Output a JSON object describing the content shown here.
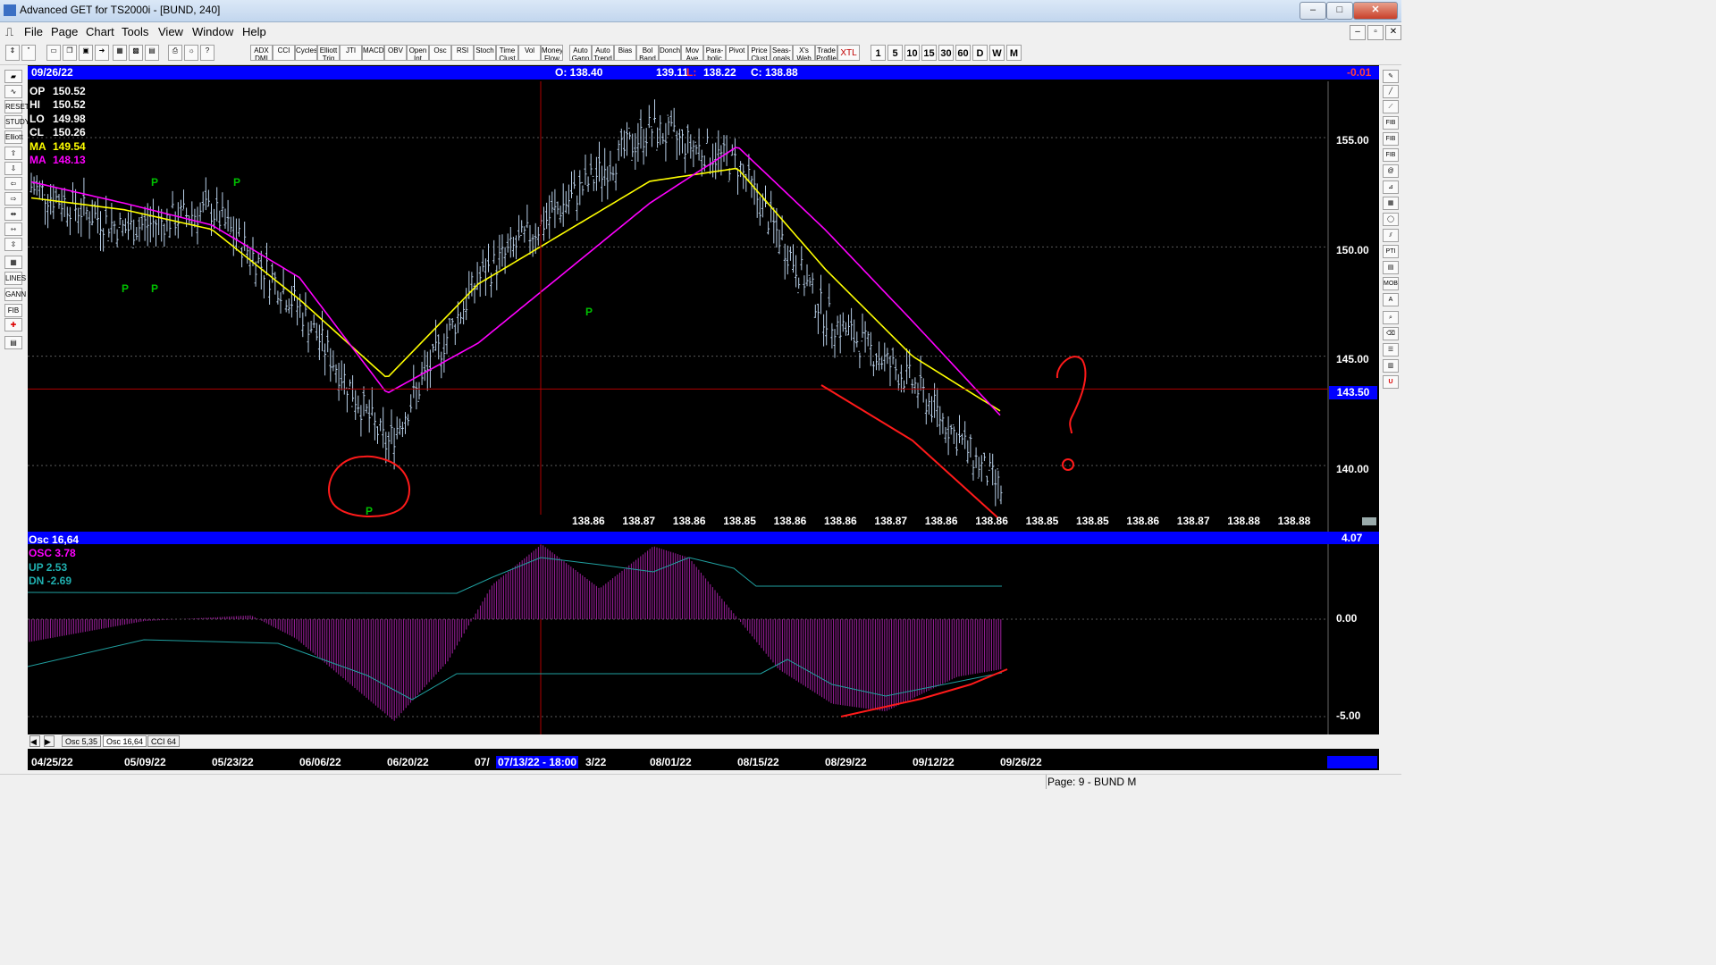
{
  "window": {
    "title": "Advanced GET for TS2000i - [BUND, 240]"
  },
  "menu": [
    "File",
    "Page",
    "Chart",
    "Tools",
    "View",
    "Window",
    "Help"
  ],
  "toolbar": {
    "indicators": [
      "ADX DMI",
      "CCI",
      "Cycles",
      "Elliott Trig",
      "JTI",
      "MACD",
      "OBV",
      "Open Int",
      "Osc",
      "RSI",
      "Stoch",
      "Time Clust",
      "Vol",
      "Money Flow",
      "Auto Gann",
      "Auto Trend",
      "Bias",
      "Bol Band",
      "Donch",
      "Mov Ave",
      "Para-bolic",
      "Pivot",
      "Price Clust",
      "Seas-onals",
      "X's Web",
      "Trade Profile",
      "XTL"
    ],
    "timeframes": [
      "1",
      "5",
      "10",
      "15",
      "30",
      "60",
      "D",
      "W",
      "M"
    ]
  },
  "lefttools": [
    "RESET",
    "STUDY",
    "Elliott",
    "LINES",
    "GANN",
    "FIB"
  ],
  "righttools": [
    "FIB RET",
    "FIB EXT",
    "FIB TIME",
    "PTI",
    "MOB"
  ],
  "header": {
    "date": "09/26/22",
    "open": "O: 138.40",
    "high": "139.11",
    "low_label": "L:",
    "low": "138.22",
    "close": "C: 138.88",
    "change": "-0.01"
  },
  "readout": [
    {
      "label": "OP",
      "value": "150.52",
      "color": "#ffffff"
    },
    {
      "label": "HI",
      "value": "150.52",
      "color": "#ffffff"
    },
    {
      "label": "LO",
      "value": "149.98",
      "color": "#ffffff"
    },
    {
      "label": "CL",
      "value": "150.26",
      "color": "#ffffff"
    },
    {
      "label": "MA",
      "value": "149.54",
      "color": "#ffff00"
    },
    {
      "label": "MA",
      "value": "148.13",
      "color": "#ff00ff"
    }
  ],
  "price_axis": [
    "155.00",
    "150.00",
    "145.00",
    "140.00"
  ],
  "cursor_price": "143.50",
  "projection_row": [
    "138.86",
    "138.87",
    "138.86",
    "138.85",
    "138.86",
    "138.86",
    "138.87",
    "138.86",
    "138.86",
    "138.85",
    "138.85",
    "138.86",
    "138.87",
    "138.88",
    "138.88"
  ],
  "pivot_marker": "P",
  "oscillator": {
    "title": "Osc 16,64",
    "osc": "OSC 3.78",
    "up": "UP   2.53",
    "dn": "DN   -2.69",
    "current": "4.07",
    "axis": [
      "0.00",
      "-5.00"
    ]
  },
  "tabs": [
    "Osc 5,35",
    "Osc 16,64",
    "CCI 64"
  ],
  "dates": [
    "04/25/22",
    "05/09/22",
    "05/23/22",
    "06/06/22",
    "06/20/22",
    "07/",
    "07/13/22 - 18:00",
    "3/22",
    "08/01/22",
    "08/15/22",
    "08/29/22",
    "09/12/22",
    "09/26/22"
  ],
  "status": "Page: 9 - BUND M",
  "colors": {
    "price_bars": "#b8cfe8",
    "ma_fast": "#ffff00",
    "ma_slow": "#ff00ff",
    "pivot": "#00c000",
    "osc_hist": "#a020a0",
    "osc_band": "#20a0a0",
    "annotation": "#ff1a1a"
  },
  "chart_data": {
    "type": "line",
    "ylim": [
      138.0,
      156.0
    ],
    "x": [
      "04/25/22",
      "05/09/22",
      "05/23/22",
      "06/06/22",
      "06/20/22",
      "07/13/22",
      "08/01/22",
      "08/15/22",
      "08/29/22",
      "09/12/22",
      "09/26/22"
    ],
    "series": [
      {
        "values": [
          152.6,
          150.8,
          151.7,
          147.2,
          140.9,
          148.5,
          155.4,
          153.8,
          146.9,
          143.8,
          138.9
        ]
      },
      {
        "values": [
          152.2,
          151.7,
          150.8,
          147.6,
          144.0,
          148.3,
          153.0,
          153.6,
          149.0,
          145.0,
          142.5
        ]
      },
      {
        "values": [
          152.9,
          152.0,
          151.0,
          148.6,
          143.3,
          145.6,
          152.0,
          154.6,
          150.8,
          146.6,
          142.3
        ]
      }
    ]
  }
}
